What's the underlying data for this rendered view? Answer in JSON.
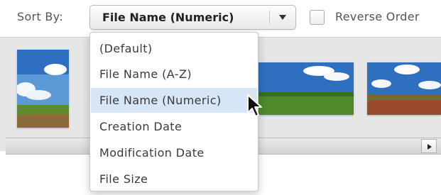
{
  "toolbar": {
    "sort_label": "Sort By:",
    "sort_value": "File Name (Numeric)",
    "reverse_label": "Reverse Order",
    "reverse_checked": false
  },
  "sort_menu": {
    "options": [
      {
        "label": "(Default)",
        "selected": false
      },
      {
        "label": "File Name (A-Z)",
        "selected": false
      },
      {
        "label": "File Name (Numeric)",
        "selected": true
      },
      {
        "label": "Creation Date",
        "selected": false
      },
      {
        "label": "Modification Date",
        "selected": false
      },
      {
        "label": "File Size",
        "selected": false
      }
    ]
  },
  "colors": {
    "selected_item_bg": "#d6e6f6",
    "sky": "#2f6fbf",
    "grass": "#4e8a2c"
  },
  "icons": [
    "chevron-down-icon",
    "scroll-right-arrow-icon",
    "mouse-pointer-icon"
  ]
}
